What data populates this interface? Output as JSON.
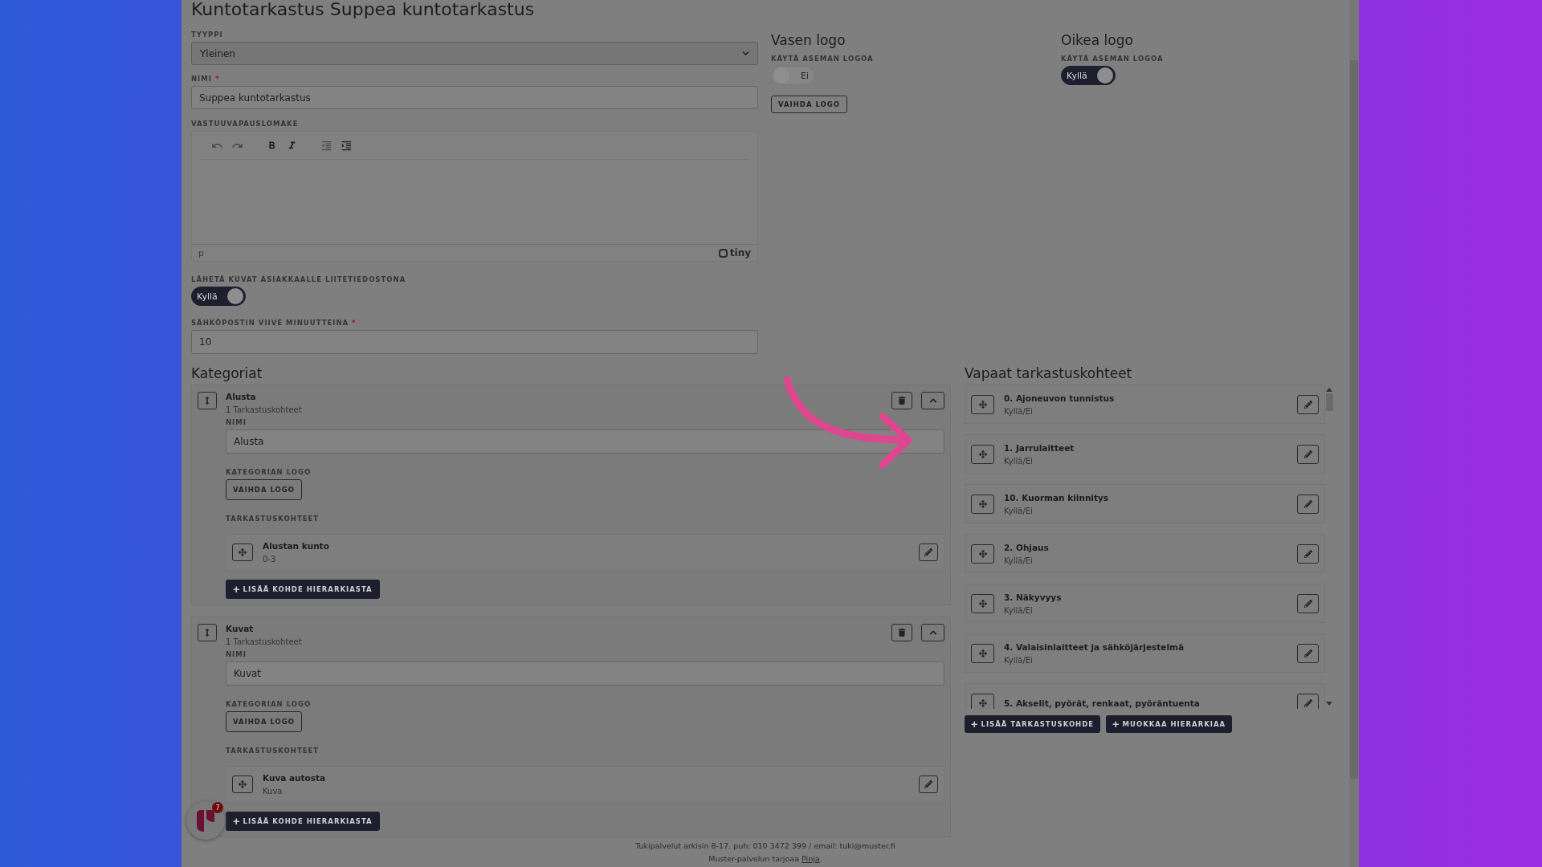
{
  "title": "Kuntotarkastus Suppea kuntotarkastus",
  "form": {
    "type_field": {
      "label": "TYYPPI",
      "value": "Yleinen"
    },
    "name_field": {
      "label": "NIMI",
      "required_mark": "*",
      "value": "Suppea kuntotarkastus"
    },
    "editor": {
      "label": "VASTUUVAPAUSLOMAKE",
      "path": "p",
      "brand": "tiny"
    },
    "attach_toggle": {
      "label": "LÄHETÄ KUVAT ASIAKKAALLE LIITETIEDOSTONA",
      "on": true,
      "text": "Kyllä"
    },
    "delay_field": {
      "label": "SÄHKÖPOSTIN VIIVE MINUUTTEINA",
      "required_mark": "*",
      "value": "10"
    }
  },
  "logos": [
    {
      "title": "Vasen logo",
      "label": "KÄYTÄ ASEMAN LOGOA",
      "on": false,
      "toggle_text": "Ei",
      "button": "VAIHDA LOGO"
    },
    {
      "title": "Oikea logo",
      "label": "KÄYTÄ ASEMAN LOGOA",
      "on": true,
      "toggle_text": "Kyllä"
    }
  ],
  "categories": {
    "title": "Kategoriat",
    "items": [
      {
        "name": "Alusta",
        "count": "1 Tarkastuskohteet",
        "name_label": "NIMI",
        "name_value": "Alusta",
        "logo_label": "KATEGORIAN LOGO",
        "logo_button": "VAIHDA LOGO",
        "items_label": "TARKASTUSKOHTEET",
        "items": [
          {
            "title": "Alustan kunto",
            "subtitle": "0-3"
          }
        ],
        "add_button": "LISÄÄ KOHDE HIERARKIASTA"
      },
      {
        "name": "Kuvat",
        "count": "1 Tarkastuskohteet",
        "name_label": "NIMI",
        "name_value": "Kuvat",
        "logo_label": "KATEGORIAN LOGO",
        "logo_button": "VAIHDA LOGO",
        "items_label": "TARKASTUSKOHTEET",
        "items": [
          {
            "title": "Kuva autosta",
            "subtitle": "Kuva"
          }
        ],
        "add_button": "LISÄÄ KOHDE HIERARKIASTA"
      }
    ]
  },
  "free_items": {
    "title": "Vapaat tarkastuskohteet",
    "items": [
      {
        "title": "0. Ajoneuvon tunnistus",
        "subtitle": "Kyllä/Ei"
      },
      {
        "title": "1. Jarrulaitteet",
        "subtitle": "Kyllä/Ei"
      },
      {
        "title": "10. Kuorman kiinnitys",
        "subtitle": "Kyllä/Ei"
      },
      {
        "title": "2. Ohjaus",
        "subtitle": "Kyllä/Ei"
      },
      {
        "title": "3. Näkyvyys",
        "subtitle": "Kyllä/Ei"
      },
      {
        "title": "4. Valaisinlaitteet ja sähköjärjestelmä",
        "subtitle": "Kyllä/Ei"
      },
      {
        "title": "5. Akselit, pyörät, renkaat, pyöräntuenta"
      }
    ],
    "buttons": [
      "LISÄÄ TARKASTUSKOHDE",
      "MUOKKAA HIERARKIAA"
    ]
  },
  "footer": {
    "support": "Tukipalvelut arkisin 8-17. puh: 010 3472 399 / email: tuki@muster.fi",
    "provider": "Muster-palvelun tarjoaa",
    "link": "Pinja",
    "end": "."
  },
  "notification_badge": "7"
}
